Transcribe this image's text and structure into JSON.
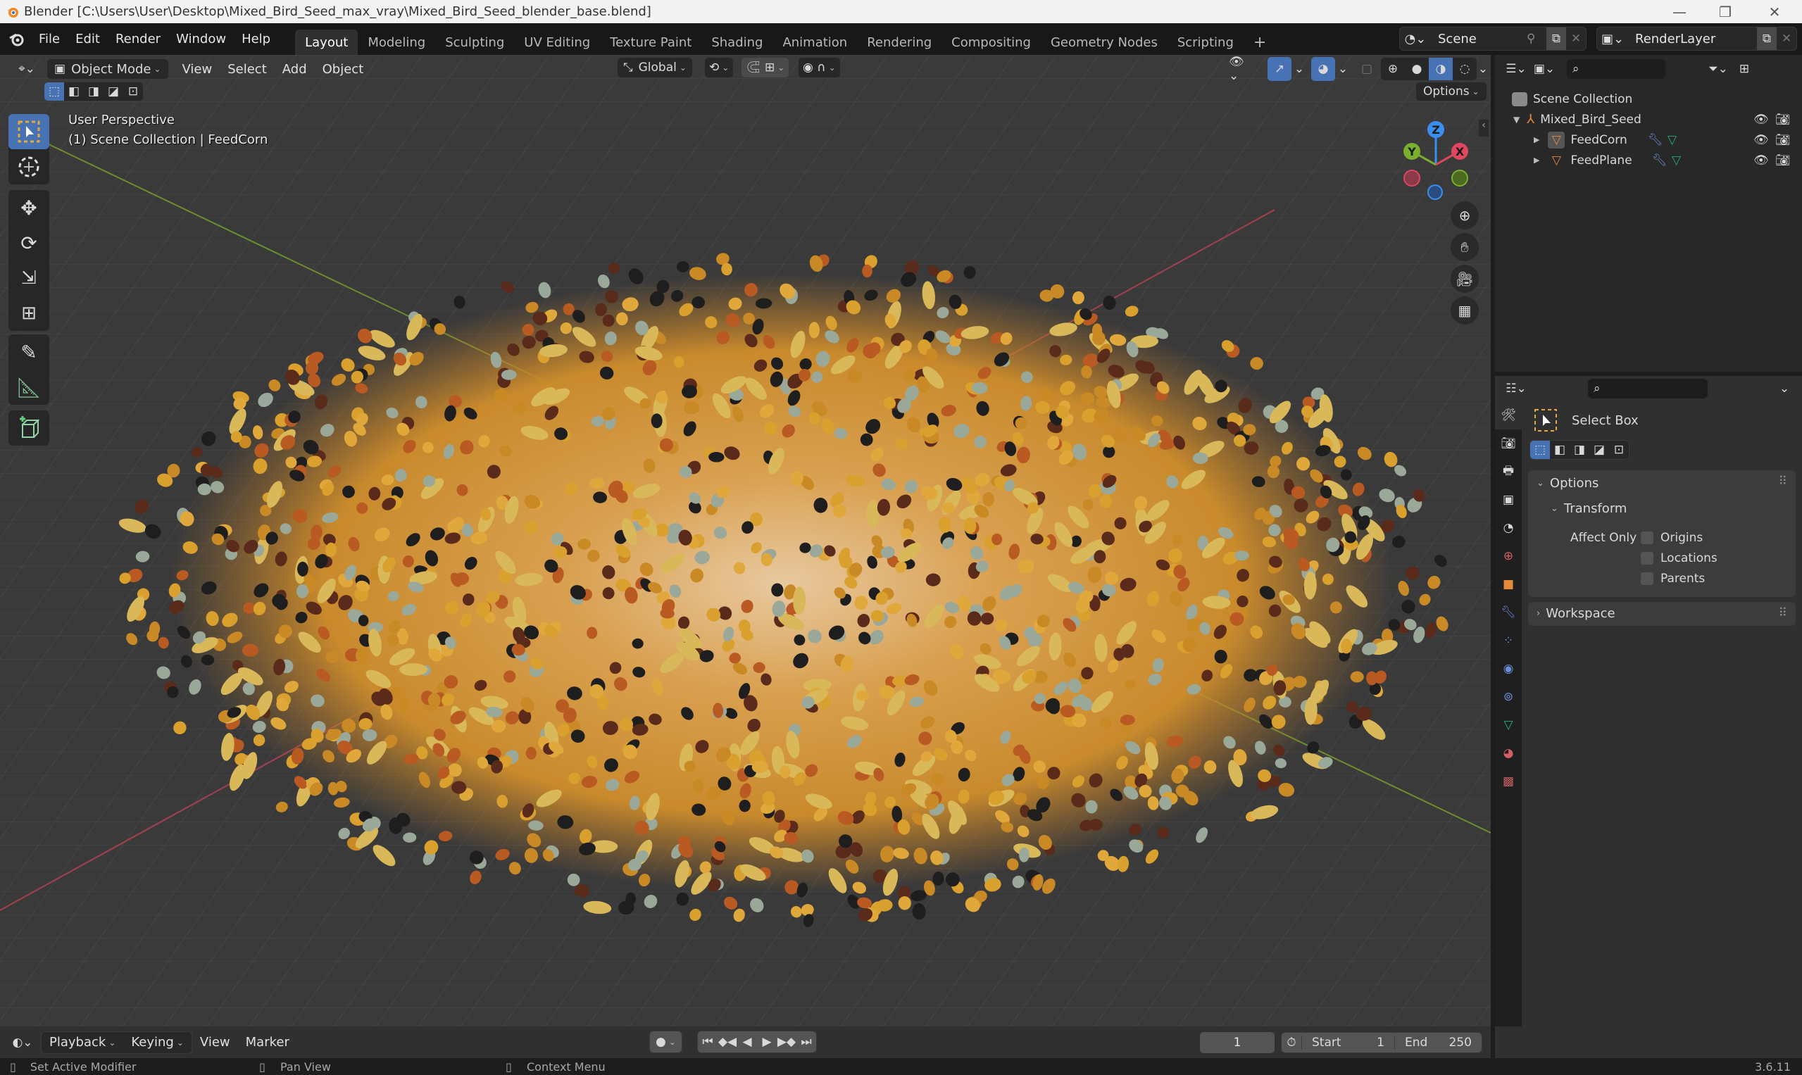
{
  "window": {
    "title": "Blender [C:\\Users\\User\\Desktop\\Mixed_Bird_Seed_max_vray\\Mixed_Bird_Seed_blender_base.blend]",
    "controls": [
      "minimize",
      "restore",
      "close"
    ]
  },
  "menubar": {
    "items": [
      "File",
      "Edit",
      "Render",
      "Window",
      "Help"
    ]
  },
  "workspaces": {
    "tabs": [
      "Layout",
      "Modeling",
      "Sculpting",
      "UV Editing",
      "Texture Paint",
      "Shading",
      "Animation",
      "Rendering",
      "Compositing",
      "Geometry Nodes",
      "Scripting"
    ],
    "active": "Layout",
    "add_label": "+"
  },
  "scene": {
    "name": "Scene"
  },
  "view_layer": {
    "name": "RenderLayer"
  },
  "viewport_header": {
    "mode": "Object Mode",
    "menus": [
      "View",
      "Select",
      "Add",
      "Object"
    ],
    "orientation": "Global",
    "options_label": "Options"
  },
  "viewport": {
    "view_name": "User Perspective",
    "context": "(1) Scene Collection | FeedCorn",
    "gizmo_axes": {
      "x": "X",
      "y": "Y",
      "z": "Z"
    },
    "axis_colors": {
      "x": "#e0475e",
      "y": "#7ab02d",
      "z": "#3b8ff0"
    }
  },
  "toolbar": {
    "tools": [
      "select-box",
      "cursor",
      "move",
      "rotate",
      "scale",
      "transform",
      "annotate",
      "measure",
      "add-cube"
    ],
    "active": "select-box"
  },
  "outliner": {
    "root": "Scene Collection",
    "items": [
      {
        "name": "Mixed_Bird_Seed",
        "type": "collection",
        "expanded": true
      },
      {
        "name": "FeedCorn",
        "type": "mesh",
        "selected": true
      },
      {
        "name": "FeedPlane",
        "type": "mesh"
      }
    ]
  },
  "properties": {
    "tool_name": "Select Box",
    "options_label": "Options",
    "transform_label": "Transform",
    "affect_only_label": "Affect Only",
    "checkboxes": [
      {
        "label": "Origins",
        "checked": false
      },
      {
        "label": "Locations",
        "checked": false
      },
      {
        "label": "Parents",
        "checked": false
      }
    ],
    "workspace_label": "Workspace"
  },
  "timeline": {
    "menus": [
      "Playback",
      "Keying",
      "View",
      "Marker"
    ],
    "current_frame": "1",
    "start_label": "Start",
    "start_value": "1",
    "end_label": "End",
    "end_value": "250"
  },
  "statusbar": {
    "hints": [
      "Set Active Modifier",
      "Pan View",
      "Context Menu"
    ],
    "version": "3.6.11"
  },
  "colors": {
    "accent": "#4772b3",
    "object_orange": "#e58a3a",
    "modifier_blue": "#6b8fd8",
    "mesh_green": "#20b07a"
  }
}
